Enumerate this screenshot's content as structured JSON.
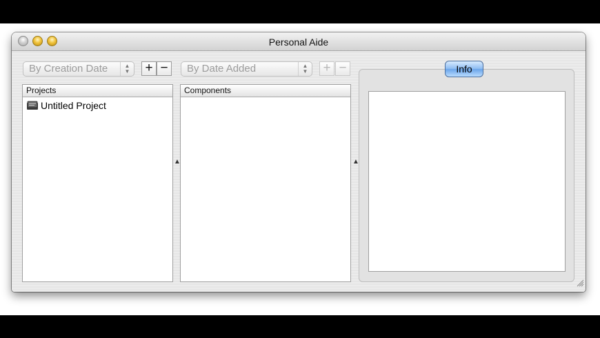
{
  "window": {
    "title": "Personal Aide"
  },
  "projects_panel": {
    "sort_popup": "By Creation Date",
    "add_label": "+",
    "remove_label": "−",
    "header": "Projects",
    "items": [
      {
        "label": "Untitled Project",
        "icon": "project-book-icon"
      }
    ]
  },
  "components_panel": {
    "sort_popup": "By Date Added",
    "add_label": "+",
    "remove_label": "−",
    "header": "Components",
    "items": []
  },
  "info_panel": {
    "tab_label": "Info"
  },
  "icons": {
    "splitter_arrow": "▲"
  },
  "colors": {
    "tab_accent": "#6aa4ea",
    "chrome": "#e8e8e8"
  }
}
